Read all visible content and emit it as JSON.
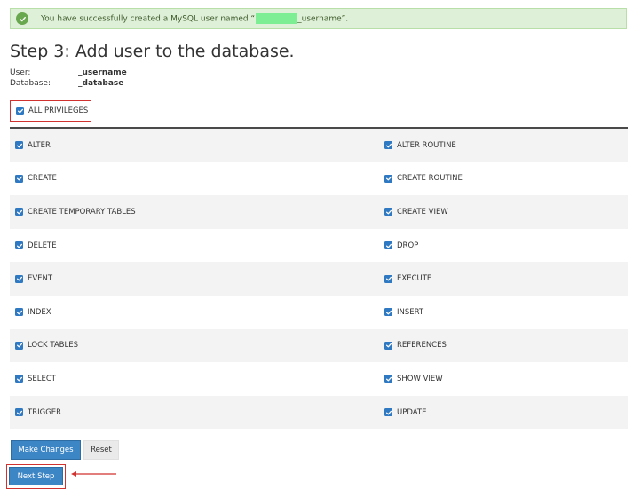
{
  "alert": {
    "text_before": "You have successfully created a MySQL user named “",
    "text_after": "_username”."
  },
  "page_title": "Step 3: Add user to the database.",
  "meta": {
    "user_label": "User:",
    "user_value": "_username",
    "database_label": "Database:",
    "database_value": "_database"
  },
  "all_privileges": {
    "label": "ALL PRIVILEGES",
    "checked": true
  },
  "privileges": [
    {
      "left": "ALTER",
      "right": "ALTER ROUTINE"
    },
    {
      "left": "CREATE",
      "right": "CREATE ROUTINE"
    },
    {
      "left": "CREATE TEMPORARY TABLES",
      "right": "CREATE VIEW"
    },
    {
      "left": "DELETE",
      "right": "DROP"
    },
    {
      "left": "EVENT",
      "right": "EXECUTE"
    },
    {
      "left": "INDEX",
      "right": "INSERT"
    },
    {
      "left": "LOCK TABLES",
      "right": "REFERENCES"
    },
    {
      "left": "SELECT",
      "right": "SHOW VIEW"
    },
    {
      "left": "TRIGGER",
      "right": "UPDATE"
    }
  ],
  "buttons": {
    "make_changes": "Make Changes",
    "reset": "Reset",
    "next_step": "Next Step"
  },
  "colors": {
    "accent": "#3d86c6",
    "highlight": "#d0332f",
    "success_bg": "#dff0d8"
  }
}
